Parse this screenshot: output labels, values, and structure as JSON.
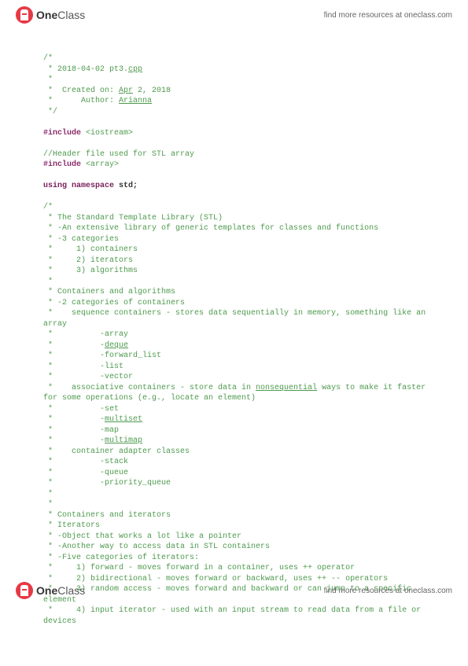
{
  "brand": {
    "logo_one": "One",
    "logo_class": "Class"
  },
  "resources_text": "find more resources at oneclass.com",
  "code": {
    "c_open": "/*",
    "c_file": " * 2018-04-02 pt3.",
    "c_file_ext": "cpp",
    "c_star": " *",
    "c_created": " *  Created on: ",
    "c_created_date_u": "Apr",
    "c_created_date_rest": " 2, 2018",
    "c_author": " *      Author: ",
    "c_author_name": "Arianna",
    "c_close": " */",
    "inc1_dir": "#include",
    "inc1_tgt": " <iostream>",
    "hdr_comment": "//Header file used for STL array",
    "inc2_dir": "#include",
    "inc2_tgt": " <array>",
    "using_k1": "using",
    "using_k2": " namespace",
    "using_id": " std",
    "using_semicolon": ";",
    "b_open": "/*",
    "b1": " * The Standard Template Library (STL)",
    "b2": " * -An extensive library of generic templates for classes and functions",
    "b3": " * -3 categories",
    "b4": " *     1) containers",
    "b5": " *     2) iterators",
    "b6": " *     3) algorithms",
    "b7": " *",
    "b8": " * Containers and algorithms",
    "b9": " * -2 categories of containers",
    "b10a": " *    sequence containers - stores data sequentially in memory, something like an",
    "b10b": "array",
    "b11": " *          -array",
    "b12a": " *          -",
    "b12u": "deque",
    "b13": " *          -forward_list",
    "b14": " *          -list",
    "b15": " *          -vector",
    "b16a": " *    associative containers - store data in ",
    "b16u": "nonsequential",
    "b16b": " ways to make it faster",
    "b16c": "for some operations (e.g., locate an element)",
    "b17": " *          -set",
    "b18a": " *          -",
    "b18u": "multiset",
    "b19": " *          -map",
    "b20a": " *          -",
    "b20u": "multimap",
    "b21": " *    container adapter classes",
    "b22": " *          -stack",
    "b23": " *          -queue",
    "b24": " *          -priority_queue",
    "b25": " *",
    "b26": " *",
    "b27": " * Containers and iterators",
    "b28": " * Iterators",
    "b29": " * -Object that works a lot like a pointer",
    "b30": " * -Another way to access data in STL containers",
    "b31": " * -Five categories of iterators:",
    "b32": " *     1) forward - moves forward in a container, uses ++ operator",
    "b33": " *     2) bidirectional - moves forward or backward, uses ++ -- operators",
    "b34a": " *     3) random access - moves forward and backward or can jump to a specific",
    "b34b": "element",
    "b35a": " *     4) input iterator - used with an input stream to read data from a file or",
    "b35b": "devices"
  }
}
